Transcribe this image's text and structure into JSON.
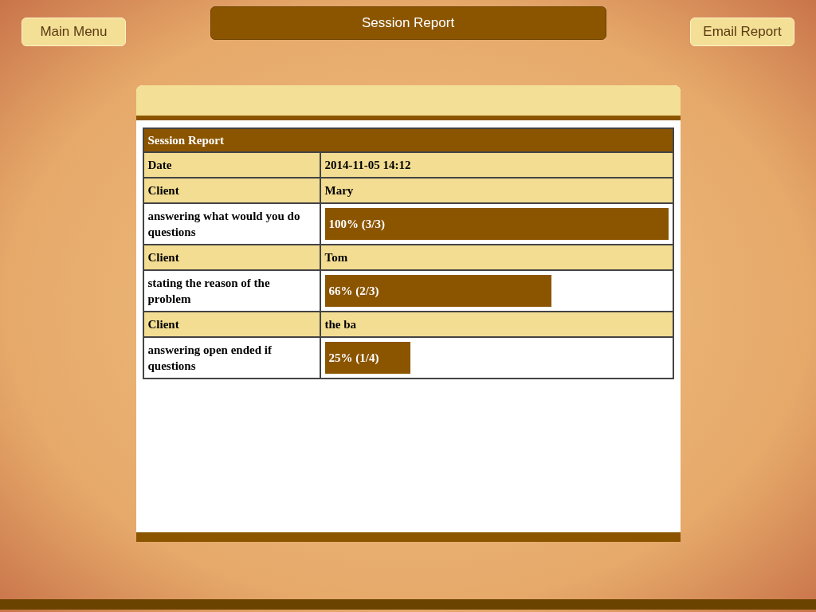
{
  "top_bar": {
    "left_button": "Main Menu",
    "title": "Session Report",
    "right_button": "Email Report"
  },
  "report": {
    "title": "Session Report",
    "rows": [
      {
        "kind": "field",
        "label": "Date",
        "value": "2014-11-05 14:12"
      },
      {
        "kind": "field",
        "label": "Client",
        "value": "Mary"
      },
      {
        "kind": "bar",
        "label": "answering what would you do questions",
        "level": 1,
        "reading": "100% (3/3)"
      },
      {
        "kind": "field",
        "label": "Client",
        "value": "Tom"
      },
      {
        "kind": "bar",
        "label": "stating the reason of the problem",
        "level": 0.66,
        "reading": "66% (2/3)"
      },
      {
        "kind": "field",
        "label": "Client",
        "value": "the ba"
      },
      {
        "kind": "bar",
        "label": "answering open ended if questions",
        "level": 0.25,
        "reading": "25% (1/4)"
      }
    ]
  }
}
